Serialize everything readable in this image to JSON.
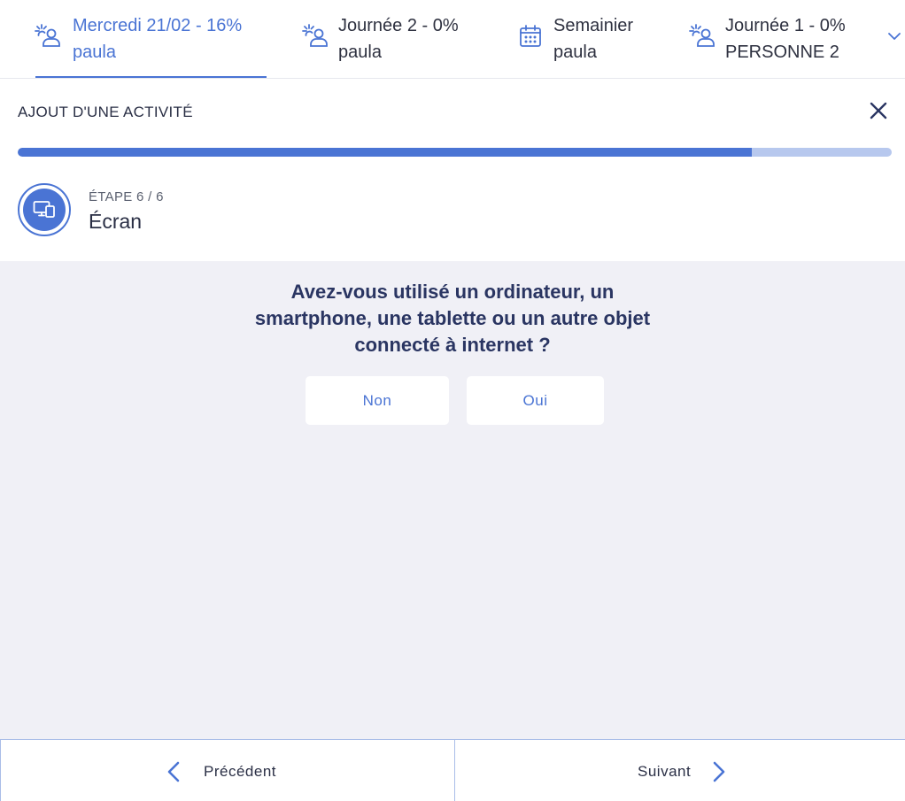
{
  "tabs": [
    {
      "line1": "Mercredi 21/02 - 16%",
      "line2": "paula",
      "icon": "person-sun-icon",
      "active": true
    },
    {
      "line1": "Journée 2 - 0%",
      "line2": "paula",
      "icon": "person-sun-icon",
      "active": false
    },
    {
      "line1": "Semainier",
      "line2": "paula",
      "icon": "calendar-icon",
      "active": false
    },
    {
      "line1": "Journée 1 - 0%",
      "line2": "PERSONNE 2",
      "icon": "person-sun-icon",
      "active": false
    }
  ],
  "panel": {
    "title": "AJOUT D'UNE ACTIVITÉ",
    "progress": 0.84
  },
  "step": {
    "label": "ÉTAPE 6 / 6",
    "name": "Écran",
    "icon": "screen-devices-icon"
  },
  "question": {
    "text": "Avez-vous utilisé un ordinateur, un smartphone, une tablette ou un autre objet connecté à internet ?",
    "answers": [
      "Non",
      "Oui"
    ]
  },
  "footer": {
    "prev_label": "Précédent",
    "next_label": "Suivant"
  },
  "colors": {
    "accent": "#4a74d4",
    "progress_track": "#b7c8ee",
    "question_bg": "#f0f0f6",
    "question_text": "#2a3562"
  }
}
